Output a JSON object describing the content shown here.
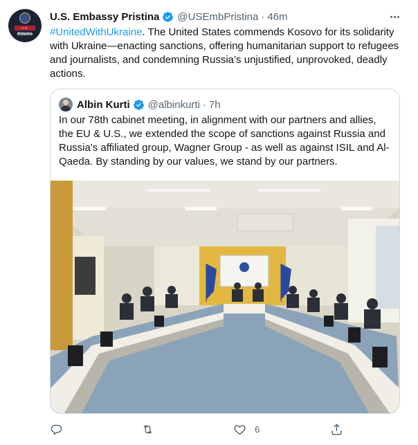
{
  "account": {
    "name": "U.S. Embassy Pristina",
    "handle": "@USEmbPristina",
    "time": "46m",
    "avatar_band": "U.S. EMBASSY",
    "avatar_location": "Kosovo"
  },
  "tweet": {
    "hashtag": "#UnitedWithUkraine",
    "body": ". The United States commends Kosovo for its solidarity with Ukraine—enacting sanctions, offering humanitarian support to refugees and journalists, and condemning Russia’s unjustified, unprovoked, deadly actions."
  },
  "quote": {
    "name": "Albin Kurti",
    "handle": "@albinkurti",
    "time": "7h",
    "body": "In our 78th cabinet meeting, in alignment with our partners and allies, the EU & U.S., we extended the scope of sanctions against Russia and Russia's affiliated group, Wagner Group - as well as against ISIL and Al-Qaeda. By standing by our values, we stand by our partners."
  },
  "actions": {
    "reply": {
      "icon": "reply-icon",
      "count": ""
    },
    "retweet": {
      "icon": "retweet-icon",
      "count": ""
    },
    "like": {
      "icon": "heart-icon",
      "count": "6"
    },
    "share": {
      "icon": "share-icon",
      "count": ""
    }
  },
  "colors": {
    "accent": "#1d9bf0",
    "text": "#0f1419",
    "secondary": "#536471",
    "border": "#cfd9de"
  }
}
